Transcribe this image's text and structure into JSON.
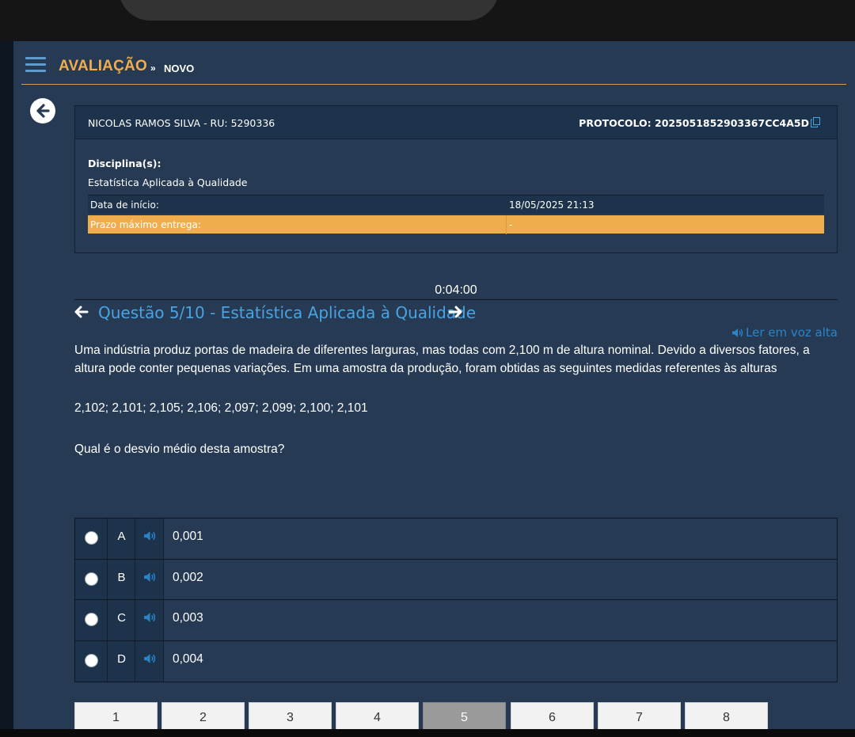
{
  "header": {
    "title": "AVALIAÇÃO",
    "separator": "»",
    "subtitle": "NOVO"
  },
  "info": {
    "student": "NICOLAS RAMOS SILVA - RU: 5290336",
    "protocol": "PROTOCOLO: 2025051852903367CC4A5D",
    "disciplines_label": "Disciplina(s):",
    "discipline_name": "Estatística Aplicada à Qualidade",
    "start_label": "Data de início:",
    "start_value": "18/05/2025 21:13",
    "deadline_label": "Prazo máximo entrega:",
    "deadline_value": "-"
  },
  "timer": "0:04:00",
  "question": {
    "title": "Questão 5/10 - Estatística Aplicada à Qualidade",
    "tts_label": "Ler em voz alta",
    "paragraph1": "Uma indústria produz portas de madeira de diferentes larguras, mas todas com 2,100 m de altura nominal. Devido a diversos fatores, a altura pode conter pequenas variações. Em uma amostra da produção, foram obtidas as seguintes medidas referentes às alturas",
    "paragraph2": "2,102; 2,101; 2,105; 2,106; 2,097; 2,099; 2,100; 2,101",
    "paragraph3": "Qual é o desvio médio desta amostra?"
  },
  "options": [
    {
      "letter": "A",
      "value": "0,001"
    },
    {
      "letter": "B",
      "value": "0,002"
    },
    {
      "letter": "C",
      "value": "0,003"
    },
    {
      "letter": "D",
      "value": "0,004"
    }
  ],
  "pager": {
    "pages": [
      "1",
      "2",
      "3",
      "4",
      "5",
      "6",
      "7",
      "8"
    ],
    "current": "5"
  },
  "colors": {
    "accent": "#f0ad4e",
    "link": "#4aa3e0",
    "background": "#263a54",
    "panel": "#1d324b"
  }
}
